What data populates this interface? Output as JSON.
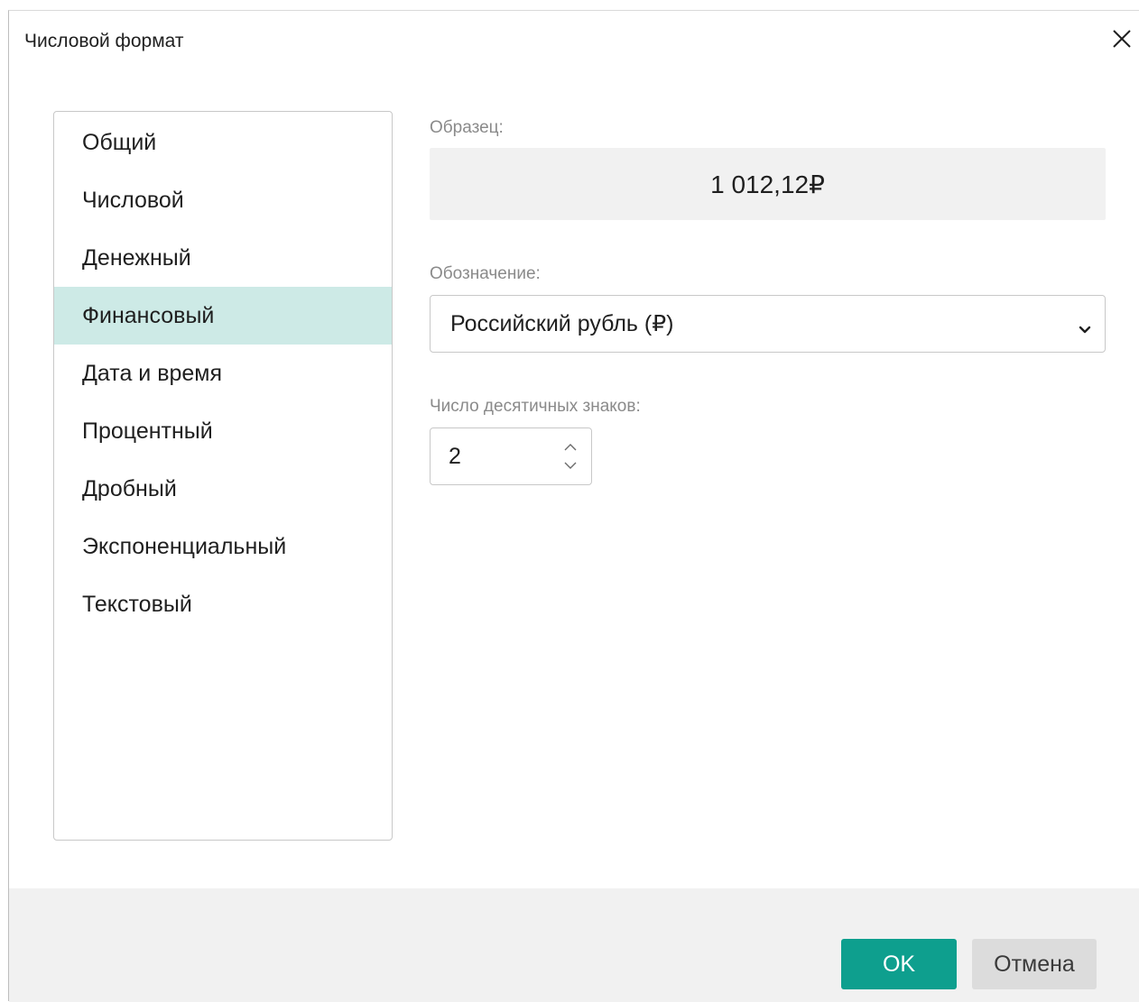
{
  "dialog": {
    "title": "Числовой формат",
    "close_icon": "close-icon"
  },
  "categories": {
    "items": [
      {
        "label": "Общий"
      },
      {
        "label": "Числовой"
      },
      {
        "label": "Денежный"
      },
      {
        "label": "Финансовый"
      },
      {
        "label": "Дата и время"
      },
      {
        "label": "Процентный"
      },
      {
        "label": "Дробный"
      },
      {
        "label": "Экспоненциальный"
      },
      {
        "label": "Текстовый"
      }
    ],
    "selected": "Финансовый"
  },
  "sample": {
    "label": "Образец:",
    "value": "1 012,12₽"
  },
  "symbol": {
    "label": "Обозначение:",
    "value": "Российский рубль (₽)",
    "icon": "chevron-down-icon"
  },
  "decimals": {
    "label": "Число десятичных знаков:",
    "value": "2",
    "up_icon": "chevron-up-icon",
    "down_icon": "chevron-down-icon"
  },
  "footer": {
    "ok_label": "OK",
    "cancel_label": "Отмена"
  },
  "colors": {
    "accent": "#0e9f8e",
    "selected_bg": "#cdeae6",
    "footer_bg": "#f1f1f1",
    "sample_bg": "#f1f1f1"
  }
}
